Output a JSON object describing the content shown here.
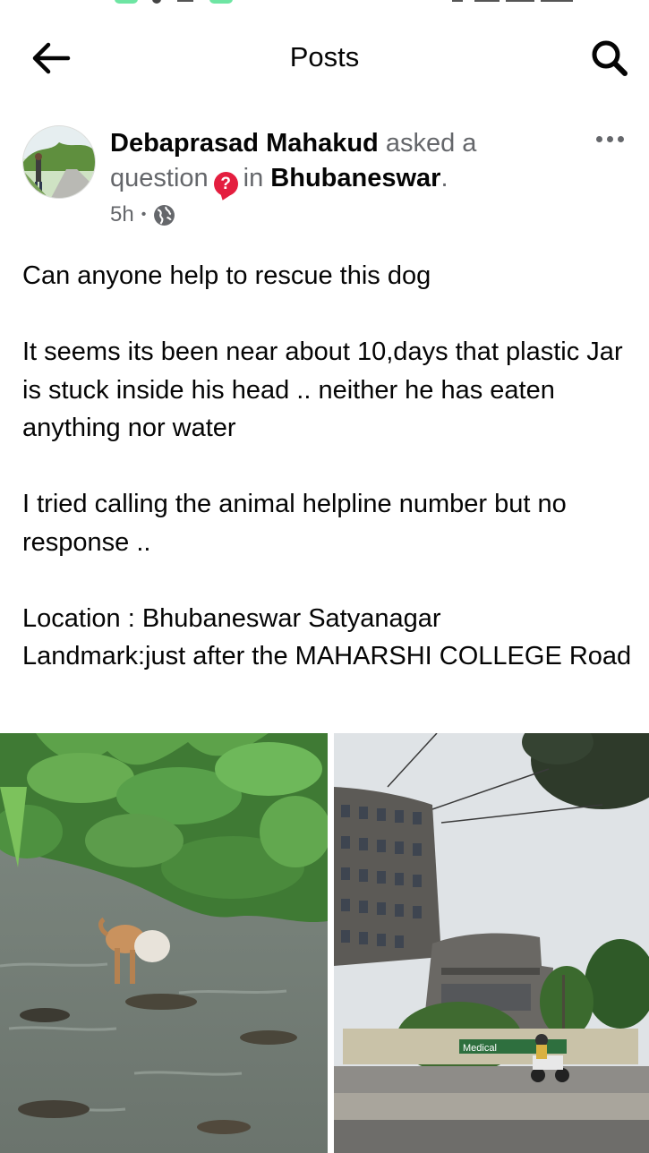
{
  "header": {
    "title": "Posts",
    "back_icon": "arrow-left-icon",
    "search_icon": "search-icon"
  },
  "post": {
    "author": "Debaprasad Mahakud",
    "action_pre": "asked a",
    "action_word": "question",
    "question_badge": "?",
    "location_pre": "in",
    "location": "Bhubaneswar",
    "location_end": ".",
    "time": "5h",
    "separator": "•",
    "privacy_icon": "globe-icon",
    "more_icon": "more-dots-icon",
    "body": {
      "line1": "Can anyone help to rescue this dog",
      "para2": "It seems its been near about 10,days that plastic Jar is stuck inside his head .. neither he has eaten anything nor water",
      "para3": "I tried calling the animal helpline number but no response ..",
      "location_line": "Location : Bhubaneswar Satyanagar",
      "landmark_line": "Landmark:just after the MAHARSHI COLLEGE Road"
    },
    "photos": [
      {
        "name": "dog-in-water-photo"
      },
      {
        "name": "building-roadside-photo",
        "sign_text": "Medical"
      }
    ]
  },
  "colors": {
    "text_primary": "#050505",
    "text_secondary": "#65676b",
    "question_badge": "#e41e3f"
  }
}
